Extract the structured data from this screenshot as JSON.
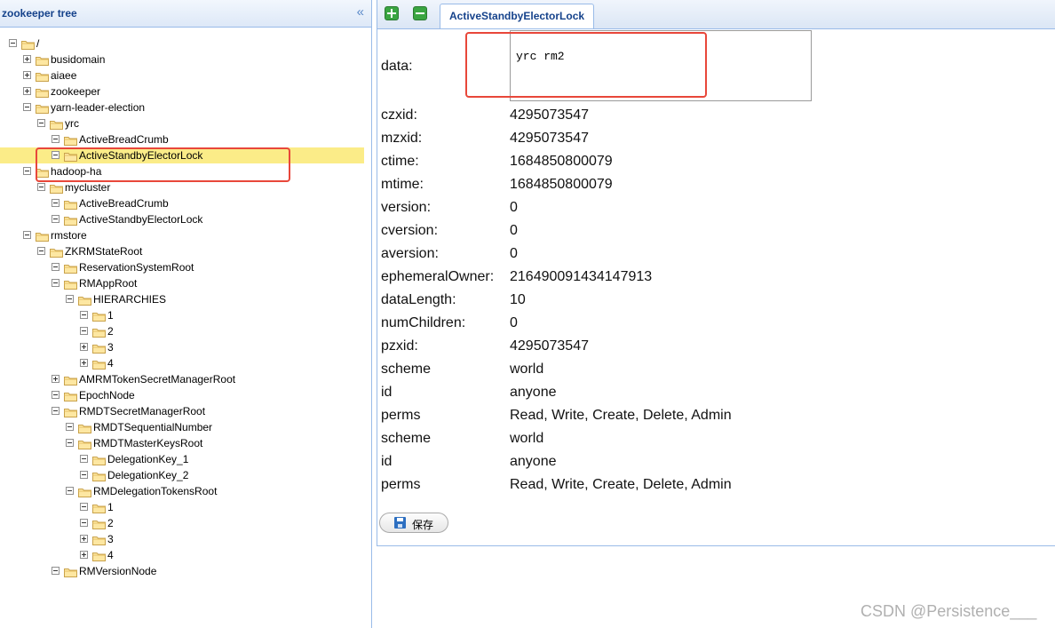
{
  "tree": {
    "title": "zookeeper tree",
    "collapse_symbol": "«",
    "nodes": [
      {
        "label": "/",
        "toggle": "minus",
        "selected": false
      },
      {
        "label": "busidomain",
        "toggle": "plus",
        "selected": false
      },
      {
        "label": "aiaee",
        "toggle": "plus",
        "selected": false
      },
      {
        "label": "zookeeper",
        "toggle": "plus",
        "selected": false
      },
      {
        "label": "yarn-leader-election",
        "toggle": "minus",
        "selected": false
      },
      {
        "label": "yrc",
        "toggle": "minus",
        "selected": false
      },
      {
        "label": "ActiveBreadCrumb",
        "toggle": "minus",
        "selected": false
      },
      {
        "label": "ActiveStandbyElectorLock",
        "toggle": "minus",
        "selected": true
      },
      {
        "label": "hadoop-ha",
        "toggle": "minus",
        "selected": false
      },
      {
        "label": "mycluster",
        "toggle": "minus",
        "selected": false
      },
      {
        "label": "ActiveBreadCrumb",
        "toggle": "minus",
        "selected": false
      },
      {
        "label": "ActiveStandbyElectorLock",
        "toggle": "minus",
        "selected": false
      },
      {
        "label": "rmstore",
        "toggle": "minus",
        "selected": false
      },
      {
        "label": "ZKRMStateRoot",
        "toggle": "minus",
        "selected": false
      },
      {
        "label": "ReservationSystemRoot",
        "toggle": "minus",
        "selected": false
      },
      {
        "label": "RMAppRoot",
        "toggle": "minus",
        "selected": false
      },
      {
        "label": "HIERARCHIES",
        "toggle": "minus",
        "selected": false
      },
      {
        "label": "1",
        "toggle": "minus",
        "selected": false
      },
      {
        "label": "2",
        "toggle": "minus",
        "selected": false
      },
      {
        "label": "3",
        "toggle": "plus",
        "selected": false
      },
      {
        "label": "4",
        "toggle": "plus",
        "selected": false
      },
      {
        "label": "AMRMTokenSecretManagerRoot",
        "toggle": "plus",
        "selected": false
      },
      {
        "label": "EpochNode",
        "toggle": "minus",
        "selected": false
      },
      {
        "label": "RMDTSecretManagerRoot",
        "toggle": "minus",
        "selected": false
      },
      {
        "label": "RMDTSequentialNumber",
        "toggle": "minus",
        "selected": false
      },
      {
        "label": "RMDTMasterKeysRoot",
        "toggle": "minus",
        "selected": false
      },
      {
        "label": "DelegationKey_1",
        "toggle": "minus",
        "selected": false
      },
      {
        "label": "DelegationKey_2",
        "toggle": "minus",
        "selected": false
      },
      {
        "label": "RMDelegationTokensRoot",
        "toggle": "minus",
        "selected": false
      },
      {
        "label": "1",
        "toggle": "minus",
        "selected": false
      },
      {
        "label": "2",
        "toggle": "minus",
        "selected": false
      },
      {
        "label": "3",
        "toggle": "plus",
        "selected": false
      },
      {
        "label": "4",
        "toggle": "plus",
        "selected": false
      },
      {
        "label": "RMVersionNode",
        "toggle": "minus",
        "selected": false
      }
    ]
  },
  "tab": {
    "label": "ActiveStandbyElectorLock"
  },
  "detail": {
    "data_label": "data:",
    "data_value": "yrc rm2",
    "props": [
      {
        "key": "czxid:",
        "value": "4295073547"
      },
      {
        "key": "mzxid:",
        "value": "4295073547"
      },
      {
        "key": "ctime:",
        "value": "1684850800079"
      },
      {
        "key": "mtime:",
        "value": "1684850800079"
      },
      {
        "key": "version:",
        "value": "0"
      },
      {
        "key": "cversion:",
        "value": "0"
      },
      {
        "key": "aversion:",
        "value": "0"
      },
      {
        "key": "ephemeralOwner:",
        "value": "216490091434147913"
      },
      {
        "key": "dataLength:",
        "value": "10"
      },
      {
        "key": "numChildren:",
        "value": "0"
      },
      {
        "key": "pzxid:",
        "value": "4295073547"
      },
      {
        "key": "scheme",
        "value": "world"
      },
      {
        "key": "id",
        "value": "anyone"
      },
      {
        "key": "perms",
        "value": "Read, Write, Create, Delete, Admin"
      },
      {
        "key": "scheme",
        "value": "world"
      },
      {
        "key": "id",
        "value": "anyone"
      },
      {
        "key": "perms",
        "value": "Read, Write, Create, Delete, Admin"
      }
    ],
    "save_label": "保存"
  },
  "colors": {
    "highlight_box": "#e8473a",
    "selected_row": "#fbec88",
    "panel_border": "#99bbe8"
  },
  "watermark": "CSDN @Persistence___"
}
